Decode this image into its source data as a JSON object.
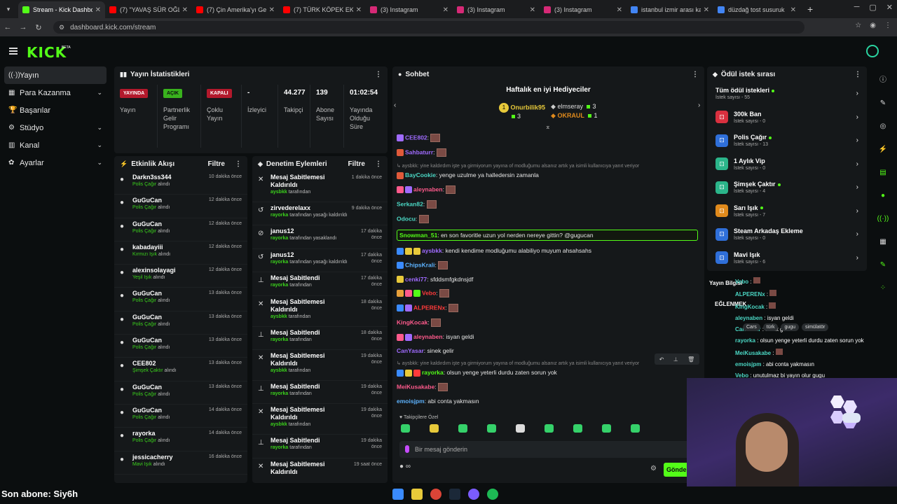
{
  "browser": {
    "tabs": [
      {
        "title": "Stream - Kick Dashboard",
        "color": "#53fc18"
      },
      {
        "title": "(7) \"YAVAŞ SÜR OĞLUM",
        "color": "#ff0000"
      },
      {
        "title": "(7) Çin Amerika'yı Geçti",
        "color": "#ff0000"
      },
      {
        "title": "(7) TÜRK KÖPEK EKMEK",
        "color": "#ff0000"
      },
      {
        "title": "(3) Instagram",
        "color": "#d62976"
      },
      {
        "title": "(3) Instagram",
        "color": "#d62976"
      },
      {
        "title": "(3) Instagram",
        "color": "#d62976"
      },
      {
        "title": "istanbul izmir arası kaç",
        "color": "#4285f4"
      },
      {
        "title": "düzdağ tost susuruk",
        "color": "#4285f4"
      }
    ],
    "url": "dashboard.kick.com/stream",
    "new_tab": "+"
  },
  "header": {
    "logo": "KICK",
    "beta": "BETA"
  },
  "sidebar": {
    "items": [
      {
        "icon": "((·))",
        "label": "Yayın",
        "chev": ""
      },
      {
        "icon": "▦",
        "label": "Para Kazanma",
        "chev": "⌄"
      },
      {
        "icon": "🏆",
        "label": "Başarılar",
        "chev": ""
      },
      {
        "icon": "⚙",
        "label": "Stüdyo",
        "chev": "⌄"
      },
      {
        "icon": "▥",
        "label": "Kanal",
        "chev": "⌄"
      },
      {
        "icon": "✿",
        "label": "Ayarlar",
        "chev": "⌄"
      }
    ]
  },
  "stats": {
    "title": "Yayın İstatistikleri",
    "items": [
      {
        "badge": "YAYINDA",
        "label": "Yayın"
      },
      {
        "badge": "AÇIK",
        "label": "Partnerlik Gelir Programı"
      },
      {
        "badge": "KAPALI",
        "label": "Çoklu Yayın"
      },
      {
        "value": "-",
        "label": "İzleyici"
      },
      {
        "value": "44.277",
        "label": "Takipçi"
      },
      {
        "value": "139",
        "label": "Abone Sayısı"
      },
      {
        "value": "01:02:54",
        "label": "Yayında Olduğu Süre"
      }
    ]
  },
  "activity": {
    "title": "Etkinlik Akışı",
    "filter": "Filtre",
    "rows": [
      {
        "name": "Darkn3ss344",
        "reward": "Polis Çağır",
        "suffix": "alındı",
        "time": "10 dakika önce"
      },
      {
        "name": "GuGuCan",
        "reward": "Polis Çağır",
        "suffix": "alındı",
        "time": "12 dakika önce"
      },
      {
        "name": "GuGuCan",
        "reward": "Polis Çağır",
        "suffix": "alındı",
        "time": "12 dakika önce"
      },
      {
        "name": "kabadayiii",
        "reward": "Kırmızı Işık",
        "suffix": "alındı",
        "time": "12 dakika önce"
      },
      {
        "name": "alexinsolayagi",
        "reward": "Yeşil Işık",
        "suffix": "alındı",
        "time": "12 dakika önce"
      },
      {
        "name": "GuGuCan",
        "reward": "Polis Çağır",
        "suffix": "alındı",
        "time": "13 dakika önce"
      },
      {
        "name": "GuGuCan",
        "reward": "Polis Çağır",
        "suffix": "alındı",
        "time": "13 dakika önce"
      },
      {
        "name": "GuGuCan",
        "reward": "Polis Çağır",
        "suffix": "alındı",
        "time": "13 dakika önce"
      },
      {
        "name": "CEE802",
        "reward": "Şimşek Çaktır",
        "suffix": "alındı",
        "time": "13 dakika önce"
      },
      {
        "name": "GuGuCan",
        "reward": "Polis Çağır",
        "suffix": "alındı",
        "time": "13 dakika önce"
      },
      {
        "name": "GuGuCan",
        "reward": "Polis Çağır",
        "suffix": "alındı",
        "time": "14 dakika önce"
      },
      {
        "name": "rayorka",
        "reward": "Polis Çağır",
        "suffix": "alındı",
        "time": "14 dakika önce"
      },
      {
        "name": "jessicacherry",
        "reward": "Mavi Işık",
        "suffix": "alındı",
        "time": "16 dakika önce"
      }
    ]
  },
  "moderation": {
    "title": "Denetim Eylemleri",
    "filter": "Filtre",
    "rows": [
      {
        "icon": "✕",
        "title": "Mesaj Sabitlemesi Kaldırıldı",
        "who": "aysbkk",
        "sub": "tarafından",
        "time": "1 dakika önce",
        "tall": true
      },
      {
        "icon": "↺",
        "title": "zirvederelaxx",
        "who": "rayorka",
        "sub": "tarafından yasağı kaldırıldı",
        "time": "9 dakika önce",
        "tall": false
      },
      {
        "icon": "⊘",
        "title": "janus12",
        "who": "rayorka",
        "sub": "tarafından yasaklandı",
        "time": "17 dakika önce",
        "tall": false
      },
      {
        "icon": "↺",
        "title": "janus12",
        "who": "rayorka",
        "sub": "tarafından yasağı kaldırıldı",
        "time": "17 dakika önce",
        "tall": false
      },
      {
        "icon": "⊥",
        "title": "Mesaj Sabitlendi",
        "who": "rayorka",
        "sub": "tarafından",
        "time": "17 dakika önce",
        "tall": false
      },
      {
        "icon": "✕",
        "title": "Mesaj Sabitlemesi Kaldırıldı",
        "who": "aysbkk",
        "sub": "tarafından",
        "time": "18 dakika önce",
        "tall": true
      },
      {
        "icon": "⊥",
        "title": "Mesaj Sabitlendi",
        "who": "rayorka",
        "sub": "tarafından",
        "time": "18 dakika önce",
        "tall": false
      },
      {
        "icon": "✕",
        "title": "Mesaj Sabitlemesi Kaldırıldı",
        "who": "aysbkk",
        "sub": "tarafından",
        "time": "19 dakika önce",
        "tall": true
      },
      {
        "icon": "⊥",
        "title": "Mesaj Sabitlendi",
        "who": "rayorka",
        "sub": "tarafından",
        "time": "19 dakika önce",
        "tall": false
      },
      {
        "icon": "✕",
        "title": "Mesaj Sabitlemesi Kaldırıldı",
        "who": "aysbkk",
        "sub": "tarafından",
        "time": "19 dakika önce",
        "tall": true
      },
      {
        "icon": "⊥",
        "title": "Mesaj Sabitlendi",
        "who": "rayorka",
        "sub": "tarafından",
        "time": "19 dakika önce",
        "tall": false
      },
      {
        "icon": "✕",
        "title": "Mesaj Sabitlemesi Kaldırıldı",
        "who": "",
        "sub": "",
        "time": "19 saat önce",
        "tall": true
      }
    ]
  },
  "chat": {
    "title": "Sohbet",
    "gifters_title": "Haftalık en iyi Hediyeciler",
    "gifters": [
      {
        "name": "Onurbilik95",
        "count": "3",
        "rank": "1"
      },
      {
        "name": "elmseray",
        "count": "3"
      },
      {
        "name": "OKRAUL",
        "count": "1"
      }
    ],
    "messages": [
      {
        "user": "CEE802",
        "cls": "u-purple",
        "text": "",
        "emote": true,
        "badges": [
          "#a06bff"
        ]
      },
      {
        "user": "Sahbaturr",
        "cls": "u-purple",
        "text": "",
        "emote": true,
        "badges": [
          "#e05a3a"
        ]
      },
      {
        "reply": "↳ aysbkk: yine kaldırdım işte ya girmiyorum yayına of modluğumu alsanız artık ya isimli kullanıcıya yanıt veriyor",
        "user": "BayCookie",
        "cls": "u-teal",
        "text": "yenge uzulme ya halledersin zamanla",
        "badges": [
          "#e05a3a"
        ]
      },
      {
        "user": "aleynaben",
        "cls": "u-pink",
        "text": "",
        "emote": true,
        "badges": [
          "#ff5a8c",
          "#a06bff"
        ]
      },
      {
        "user": "Serkan82",
        "cls": "u-teal",
        "text": "",
        "emote": true,
        "badges": []
      },
      {
        "user": "Odocu",
        "cls": "u-teal",
        "text": "",
        "emote": true,
        "badges": []
      },
      {
        "user": "Snowman_51",
        "cls": "u-green",
        "text": "en son favoritle uzun yol nerden nereye gittin? @gugucan",
        "highlight": true,
        "badges": []
      },
      {
        "user": "aysbkk",
        "cls": "u-purple",
        "text": "kendi kendime modluğumu alabiliyo muyum ahsahsahs",
        "badges": [
          "#3a8bff",
          "#e7c93a",
          "#e7c93a"
        ]
      },
      {
        "user": "ChipsKrali",
        "cls": "u-blue",
        "text": "",
        "emote": true,
        "badges": [
          "#3a8bff"
        ]
      },
      {
        "user": "cenki77",
        "cls": "u-purple",
        "text": "sfddsmfgkdnsjdf",
        "badges": [
          "#e7c93a"
        ]
      },
      {
        "user": "Vebo",
        "cls": "u-red",
        "text": "",
        "emote": true,
        "badges": [
          "#e7a03a",
          "#ff5a8c",
          "#53fc18"
        ]
      },
      {
        "user": "ALPERENx",
        "cls": "u-red",
        "text": "",
        "emote": true,
        "badges": [
          "#3a8bff",
          "#a06bff"
        ]
      },
      {
        "user": "KingKocak",
        "cls": "u-pink",
        "text": "",
        "emote": true,
        "badges": []
      },
      {
        "user": "aleynaben",
        "cls": "u-pink",
        "text": "isyan geldi",
        "badges": [
          "#ff5a8c",
          "#a06bff"
        ]
      },
      {
        "user": "CanYasar",
        "cls": "u-purple",
        "text": "sinek gelir",
        "badges": []
      },
      {
        "reply": "↳ aysbkk: yine kaldırdım işte ya girmiyorum yayına of modluğumu alsanız artık ya isimli kullanıcıya yanıt veriyor",
        "user": "rayorka",
        "cls": "u-green",
        "text": "olsun yenge yeterli durdu zaten sorun yok",
        "badges": [
          "#3a8bff",
          "#e7c93a",
          "#ff3a3a"
        ]
      },
      {
        "user": "MeiKusakabe",
        "cls": "u-pink",
        "text": "",
        "emote": true,
        "badges": []
      },
      {
        "user": "emoisjpm",
        "cls": "u-blue",
        "text": "abi conta yakmasın",
        "badges": []
      },
      {
        "user": "Vebo",
        "cls": "u-red",
        "text": "unutulmaz bi yayın olur gugu",
        "badges": [
          "#e7a03a",
          "#ff5a8c",
          "#53fc18"
        ]
      },
      {
        "user": "aysbkk",
        "cls": "u-purple",
        "text": "rayorka nefret edecek benden artık",
        "badges": [
          "#3a8bff",
          "#e7c93a",
          "#e7c93a"
        ]
      }
    ],
    "emote_title": "♥ Takipçilere Özel",
    "input_placeholder": "Bir mesaj gönderin",
    "send": "Gönder",
    "footer_icon": "∞"
  },
  "rewards": {
    "title": "Ödül istek sırası",
    "rows": [
      {
        "title": "Tüm ödül istekleri",
        "sub": "İstek sayısı - 55",
        "color": "",
        "icon": "",
        "live": true
      },
      {
        "title": "300k Ban",
        "sub": "İstek sayısı - 0",
        "color": "#d9303f",
        "icon": "⊡",
        "live": false
      },
      {
        "title": "Polis Çağır",
        "sub": "İstek sayısı - 13",
        "color": "#2f6fd9",
        "icon": "⊡",
        "live": true
      },
      {
        "title": "1 Aylık Vip",
        "sub": "İstek sayısı - 0",
        "color": "#2bb58a",
        "icon": "⊡",
        "live": false
      },
      {
        "title": "Şimşek Çaktır",
        "sub": "İstek sayısı - 4",
        "color": "#2bb58a",
        "icon": "⊡",
        "live": true
      },
      {
        "title": "Sarı Işık",
        "sub": "İstek sayısı - 7",
        "color": "#e08a1c",
        "icon": "⊡",
        "live": true
      },
      {
        "title": "Steam Arkadaş Ekleme",
        "sub": "İstek sayısı - 0",
        "color": "#2f6fd9",
        "icon": "⊡",
        "live": false
      },
      {
        "title": "Mavi Işık",
        "sub": "İstek sayısı - 6",
        "color": "#2f6fd9",
        "icon": "⊡",
        "live": false
      }
    ]
  },
  "overlay": {
    "title": "Yayın Bilgisi",
    "subtitle": "EĞLENMEK",
    "tags": [
      "Cars",
      "türk",
      "gugu",
      "simülatör"
    ],
    "messages": [
      {
        "user": "Vebo",
        "text": ""
      },
      {
        "user": "ALPERENx",
        "text": ""
      },
      {
        "user": "KingKocak",
        "text": ""
      },
      {
        "user": "aleynaben",
        "text": "isyan geldi"
      },
      {
        "user": "CanYasar",
        "text": "sinek gelir"
      },
      {
        "user": "rayorka",
        "text": "olsun yenge yeterli durdu zaten sorun yok"
      },
      {
        "user": "MeiKusakabe",
        "text": ""
      },
      {
        "user": "emoisjpm",
        "text": "abi conta yakmasın"
      },
      {
        "user": "Vebo",
        "text": "unutulmaz bi yayın olur gugu"
      },
      {
        "user": "aysbkk",
        "text": "rayorka nefret edecek benden artık"
      }
    ]
  },
  "taskbar": {
    "last_sub": "Son abone: Siy6h"
  }
}
